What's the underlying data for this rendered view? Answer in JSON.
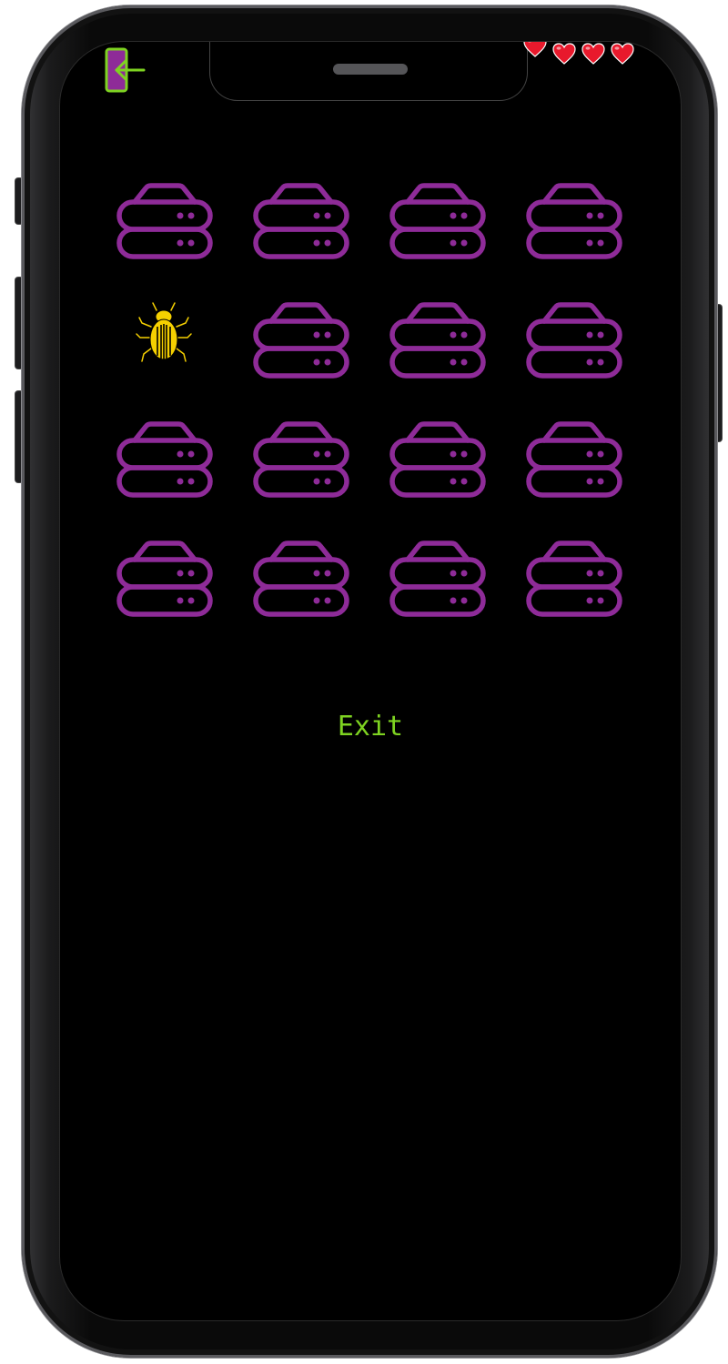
{
  "colors": {
    "server": "#8e2b98",
    "bug": "#f5d000",
    "accent_green": "#7ed321",
    "heart": "#e8192c",
    "background": "#000000"
  },
  "hud": {
    "exit_icon": "exit-door-icon",
    "lives": 4
  },
  "grid": {
    "rows": 4,
    "cols": 4,
    "cells": [
      "server",
      "server",
      "server",
      "server",
      "bug",
      "server",
      "server",
      "server",
      "server",
      "server",
      "server",
      "server",
      "server",
      "server",
      "server",
      "server"
    ]
  },
  "exit_label": "Exit"
}
